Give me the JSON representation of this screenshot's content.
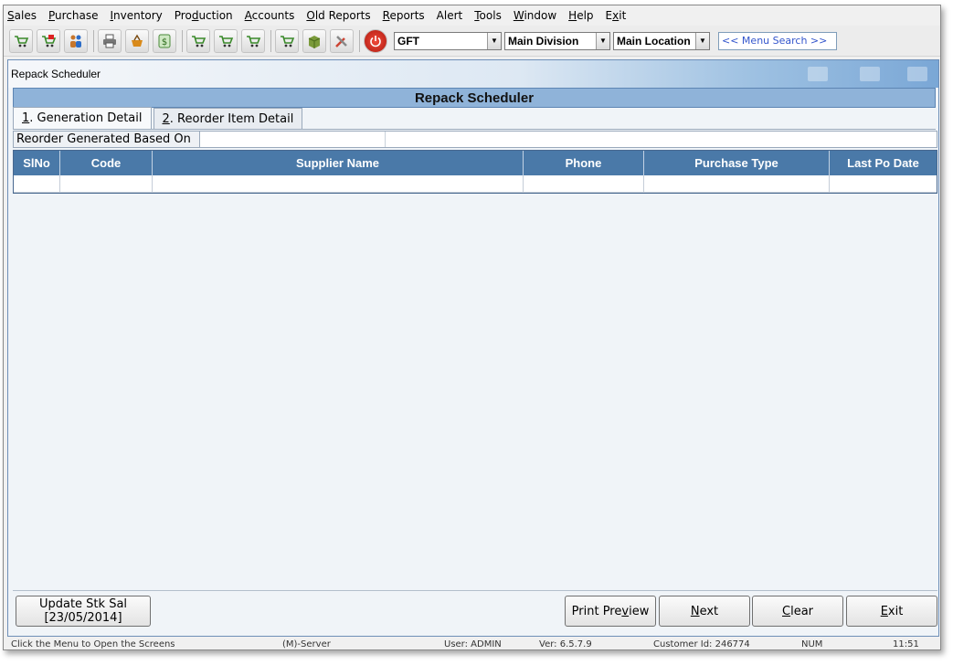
{
  "menu": [
    {
      "pre": "",
      "acc": "S",
      "post": "ales"
    },
    {
      "pre": "",
      "acc": "P",
      "post": "urchase"
    },
    {
      "pre": "",
      "acc": "I",
      "post": "nventory"
    },
    {
      "pre": "Pro",
      "acc": "d",
      "post": "uction"
    },
    {
      "pre": "",
      "acc": "A",
      "post": "ccounts"
    },
    {
      "pre": "",
      "acc": "O",
      "post": "ld Reports"
    },
    {
      "pre": "",
      "acc": "R",
      "post": "eports"
    },
    {
      "pre": "Alert",
      "acc": "",
      "post": ""
    },
    {
      "pre": "",
      "acc": "T",
      "post": "ools"
    },
    {
      "pre": "",
      "acc": "W",
      "post": "indow"
    },
    {
      "pre": "",
      "acc": "H",
      "post": "elp"
    },
    {
      "pre": "E",
      "acc": "x",
      "post": "it"
    }
  ],
  "toolbar": {
    "company": "GFT",
    "division": "Main Division",
    "location": "Main Location",
    "menu_search_placeholder": "<< Menu Search >>",
    "icons": [
      "cart-green-icon",
      "cart-red-icon",
      "people-icon",
      "printer-icon",
      "basket-icon",
      "money-icon",
      "cart-add-icon",
      "cart-check-icon",
      "cart-return-icon",
      "cart-out-icon",
      "box-icon",
      "tools-icon",
      "power-icon"
    ]
  },
  "window": {
    "title": "Repack Scheduler",
    "heading": "Repack Scheduler"
  },
  "tabs": [
    {
      "num": "1",
      "label": ". Generation Detail",
      "active": true
    },
    {
      "num": "2",
      "label": ". Reorder Item Detail",
      "active": false
    }
  ],
  "reorder": {
    "label": "Reorder Generated Based On",
    "value1": "",
    "value2": ""
  },
  "grid": {
    "columns": [
      "SlNo",
      "Code",
      "Supplier Name",
      "Phone",
      "Purchase Type",
      "Last Po Date"
    ],
    "rows": [
      [
        "",
        "",
        "",
        "",
        "",
        ""
      ]
    ]
  },
  "buttons": {
    "update_line1": "Update Stk Sal",
    "update_line2": "[23/05/2014]",
    "print_pre": "Print Pre",
    "print_acc": "v",
    "print_post": "iew",
    "next_acc": "N",
    "next_post": "ext",
    "clear_acc": "C",
    "clear_post": "lear",
    "exit_acc": "E",
    "exit_post": "xit"
  },
  "status": {
    "hint": "Click the Menu to Open the Screens",
    "server": "(M)-Server",
    "user": "User: ADMIN",
    "version": "Ver: 6.5.7.9",
    "customer": "Customer Id: 246774",
    "num": "NUM",
    "time": "11:51"
  }
}
